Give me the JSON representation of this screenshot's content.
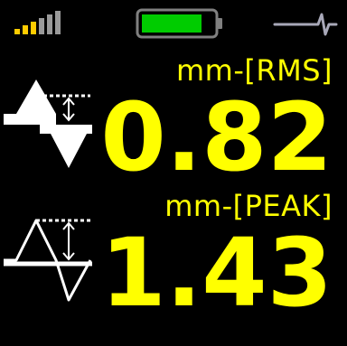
{
  "colors": {
    "accent": "#ffff00",
    "battery_fill": "#00cc00",
    "battery_frame": "#808080",
    "signal_active": "#ffcc00",
    "signal_inactive": "#9a9a9a",
    "trace": "#a8a8b8",
    "icon": "#ffffff"
  },
  "status": {
    "signal_level": 3,
    "signal_bars_total": 6,
    "battery_level": 0.85
  },
  "rms": {
    "unit": "mm-[RMS]",
    "value": "0.82"
  },
  "peak": {
    "unit": "mm-[PEAK]",
    "value": "1.43"
  }
}
